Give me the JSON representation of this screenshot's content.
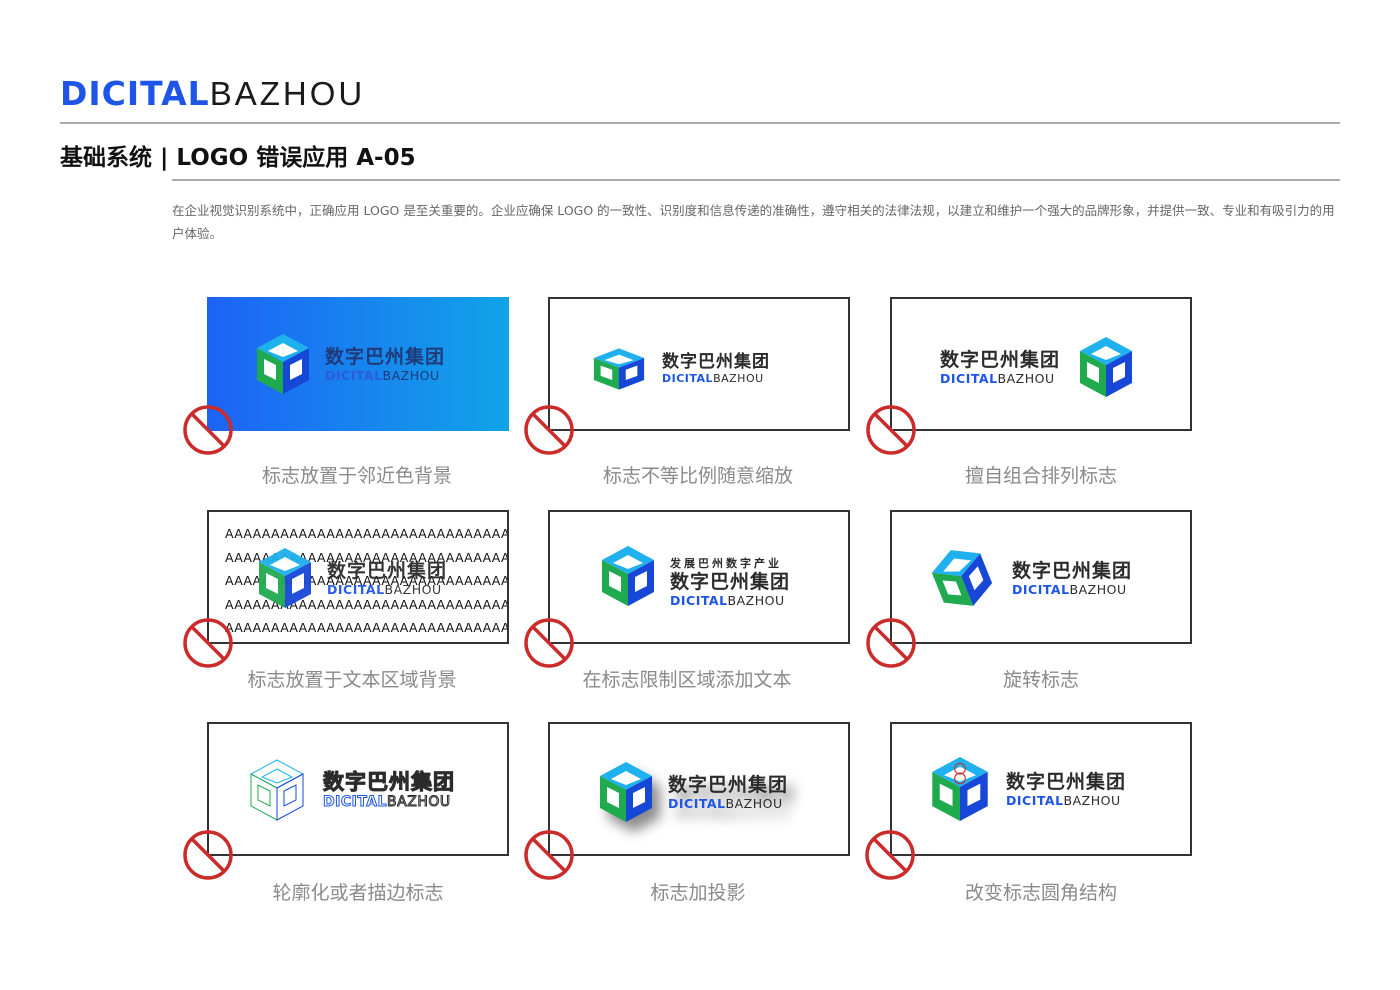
{
  "brand": {
    "part1": "DICITAL",
    "part2": "BAZHOU"
  },
  "page_title": "基础系统 | LOGO 错误应用 A-05",
  "description": "在企业视觉识别系统中，正确应用 LOGO 是至关重要的。企业应确保 LOGO 的一致性、识别度和信息传递的准确性，遵守相关的法律法规，以建立和维护一个强大的品牌形象，并提供一致、专业和有吸引力的用户体验。",
  "logo": {
    "cn": "数字巴州集团",
    "en1": "DICITAL",
    "en2": "BAZHOU",
    "tagline": "发展巴州数字产业"
  },
  "colors": {
    "blue": "#1e55e6",
    "green": "#1faa4f",
    "cube_light": "#1fb1ee",
    "cube_dark": "#1747d6",
    "ban_red": "#cc2b2b"
  },
  "text_block": [
    "AAAAAAAAAAAAAAAAAAAAAAAAAAAAAAAAA",
    "AAAAAAAAAAAAAAAAAAAAAAAAAAAAAAAAA",
    "AAAAAAAAAAAAAAAAAAAAAAAAAAAAAAAAA",
    "AAAAAAAAAAAAAAAAAAAAAAAAAAAAAAAAA",
    "AAAAAAAAAAAAAAAAAAAAAAAAAAAAAAAAA"
  ],
  "examples": [
    {
      "caption": "标志放置于邻近色背景"
    },
    {
      "caption": "标志不等比例随意缩放"
    },
    {
      "caption": "擅自组合排列标志"
    },
    {
      "caption": "标志放置于文本区域背景"
    },
    {
      "caption": "在标志限制区域添加文本"
    },
    {
      "caption": "旋转标志"
    },
    {
      "caption": "轮廓化或者描边标志"
    },
    {
      "caption": "标志加投影"
    },
    {
      "caption": "改变标志圆角结构"
    }
  ]
}
